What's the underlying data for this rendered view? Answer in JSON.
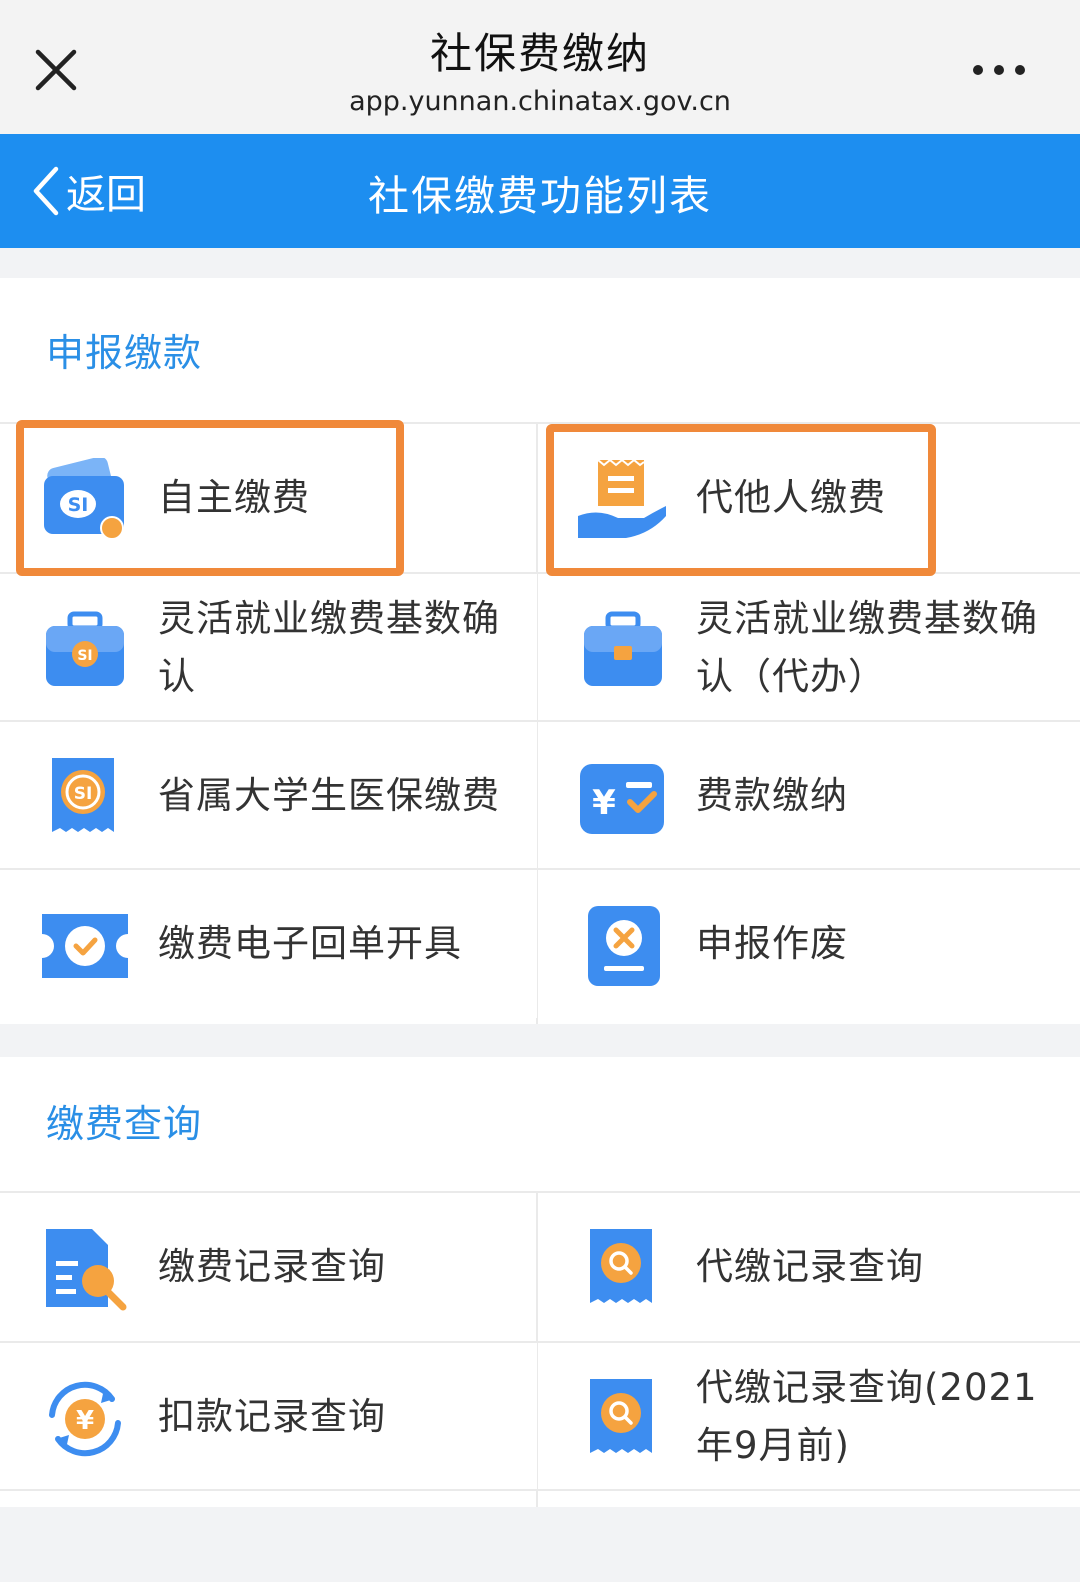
{
  "window": {
    "title": "社保费缴纳",
    "url": "app.yunnan.chinatax.gov.cn",
    "close_icon": "close-icon",
    "more_icon": "more-horizontal-icon"
  },
  "navbar": {
    "back_label": "返回",
    "title": "社保缴费功能列表"
  },
  "sections": [
    {
      "title": "申报缴款",
      "items": [
        {
          "label": "自主缴费",
          "icon": "si-card-self-icon",
          "highlighted": true
        },
        {
          "label": "代他人缴费",
          "icon": "hand-receipt-icon",
          "highlighted": true
        },
        {
          "label": "灵活就业缴费基数确认",
          "icon": "briefcase-si-icon"
        },
        {
          "label": "灵活就业缴费基数确认（代办）",
          "icon": "briefcase-icon"
        },
        {
          "label": "省属大学生医保缴费",
          "icon": "si-receipt-icon"
        },
        {
          "label": "费款缴纳",
          "icon": "yuan-check-icon"
        },
        {
          "label": "缴费电子回单开具",
          "icon": "ticket-check-icon"
        },
        {
          "label": "申报作废",
          "icon": "document-cancel-icon"
        }
      ]
    },
    {
      "title": "缴费查询",
      "items": [
        {
          "label": "缴费记录查询",
          "icon": "document-search-icon"
        },
        {
          "label": "代缴记录查询",
          "icon": "receipt-search-icon"
        },
        {
          "label": "扣款记录查询",
          "icon": "yuan-refresh-icon"
        },
        {
          "label": "代缴记录查询(2021年9月前)",
          "icon": "receipt-search-icon"
        }
      ]
    }
  ],
  "colors": {
    "accent_blue": "#1d8ef0",
    "section_title_blue": "#2a8fe6",
    "highlight_orange": "#f0893a",
    "icon_orange": "#f5a340"
  }
}
